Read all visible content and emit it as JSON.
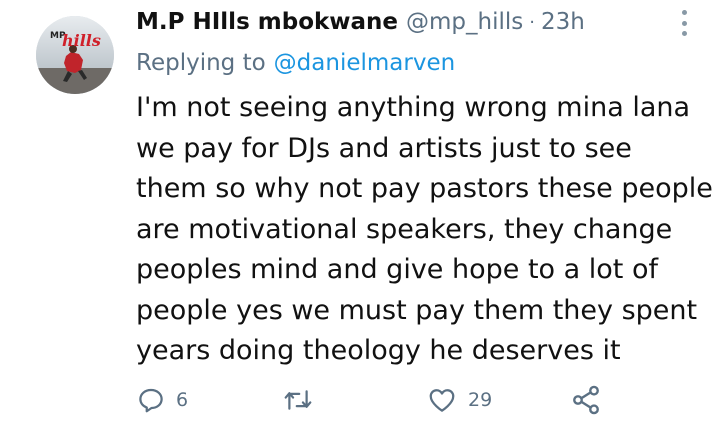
{
  "tweet": {
    "display_name": "M.P HIlls mbokwane",
    "handle": "@mp_hills",
    "separator": "·",
    "time": "23h",
    "reply_prefix": "Replying to",
    "reply_to": "@danielmarven",
    "body_lines": [
      "I'm not seeing anything wrong mina lana",
      "we pay  for DJs and artists just to see",
      "them so why not pay pastors these people",
      "are motivational speakers, they change",
      "peoples mind and give hope to a lot of",
      "people yes we must pay them they spent",
      "years doing theology he deserves it"
    ],
    "avatar_logo": {
      "line1": "MP",
      "line2": "hills"
    },
    "actions": {
      "reply": {
        "icon": "reply-icon",
        "count": "6"
      },
      "retweet": {
        "icon": "retweet-icon",
        "count": ""
      },
      "like": {
        "icon": "heart-icon",
        "count": "29"
      },
      "share": {
        "icon": "share-icon",
        "count": ""
      }
    },
    "colors": {
      "text": "#111111",
      "secondary": "#5b7083",
      "link": "#1b95e0",
      "icon": "#5b7083"
    }
  }
}
